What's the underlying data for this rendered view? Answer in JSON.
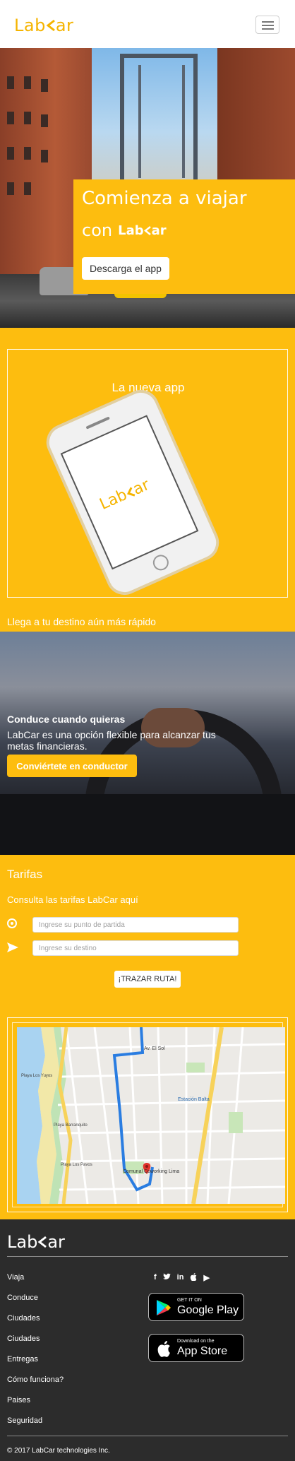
{
  "colors": {
    "brand": "#fdbd0f",
    "logo": "#f5b400",
    "footer": "#2c2c2c"
  },
  "header": {
    "logo_left": "Lab",
    "logo_right": "ar",
    "menu_icon": "hamburger-icon"
  },
  "hero": {
    "title": "Comienza a viajar",
    "subtitle_word": "con",
    "logo_left": "Lab",
    "logo_right": "ar",
    "cta": "Descarga el app"
  },
  "app": {
    "title": "La nueva app",
    "phone_logo_left": "Lab",
    "phone_logo_right": "ar",
    "tagline": "Llega a tu destino aún más rápido"
  },
  "driver": {
    "headline": "Conduce cuando quieras",
    "description": "LabCar es una opción flexible para alcanzar tus metas financieras.",
    "cta": "Conviértete en conductor"
  },
  "tarifas": {
    "title": "Tarifas",
    "subtitle": "Consulta las tarifas LabCar aquí",
    "origin_placeholder": "Ingrese su punto de partida",
    "destination_placeholder": "Ingrese su destino",
    "route_button": "¡TRAZAR RUTA!",
    "map_labels": {
      "street": "Av. El Sol",
      "station": "Estación Balta",
      "place1": "Playa Los Yuyos",
      "place2": "Playa Barranquito",
      "place3": "Playa Los Pavos",
      "marker": "Comunal Coworking Lima"
    }
  },
  "footer": {
    "logo_left": "Lab",
    "logo_right": "ar",
    "links": [
      "Viaja",
      "Conduce",
      "Ciudades",
      "Ciudades",
      "Entregas",
      "Cómo funciona?",
      "Paises",
      "Seguridad"
    ],
    "social": [
      "f",
      "t",
      "in",
      "",
      "▶"
    ],
    "google": {
      "small": "GET IT ON",
      "big": "Google Play"
    },
    "apple": {
      "small": "Download on the",
      "big": "App Store"
    },
    "copyright": "© 2017 LabCar technologies Inc."
  }
}
